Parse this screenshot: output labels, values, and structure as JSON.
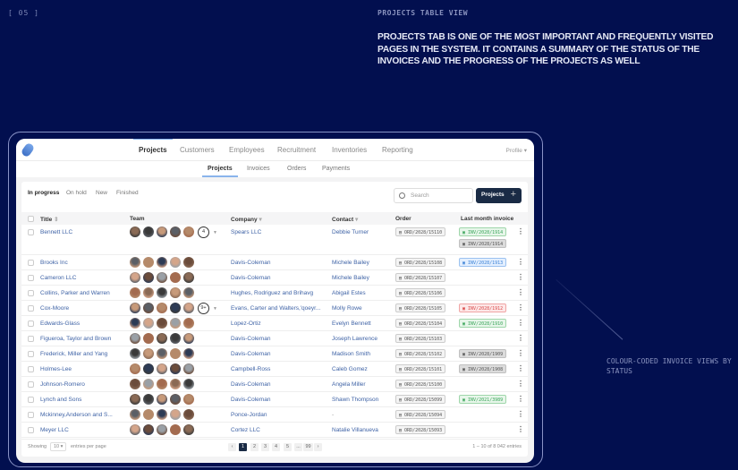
{
  "slide": {
    "number": "[ 05 ]",
    "section_title": "PROJECTS TABLE VIEW",
    "description": "PROJECTS TAB IS ONE OF THE MOST IMPORTANT AND FREQUENTLY VISITED PAGES IN THE SYSTEM. IT CONTAINS A SUMMARY OF THE STATUS OF THE INVOICES AND THE PROGRESS OF THE PROJECTS AS WELL",
    "callout": "COLOUR-CODED INVOICE VIEWS BY STATUS"
  },
  "topnav": {
    "items": [
      "Projects",
      "Customers",
      "Employees",
      "Recruitment",
      "Inventories",
      "Reporting"
    ],
    "active": 0,
    "profile": "Profile"
  },
  "subnav": {
    "items": [
      "Projects",
      "Invoices",
      "Orders",
      "Payments"
    ],
    "active": 0
  },
  "filters": {
    "items": [
      "In progress",
      "On hold",
      "New",
      "Finished"
    ],
    "active": 0
  },
  "search": {
    "placeholder": "Search"
  },
  "add_button": {
    "label": "Projects"
  },
  "table": {
    "columns": [
      "Title",
      "Team",
      "Company",
      "Contact",
      "Order",
      "Last month invoice"
    ],
    "rows": [
      {
        "title": "Bennett LLC",
        "extra": "4",
        "company": "Spears LLC",
        "contact": "Debbie Turner",
        "order": "ORD/2028/15110",
        "invoices": [
          {
            "id": "INV/2028/1914",
            "status": "green"
          },
          {
            "id": "INV/2028/1914",
            "status": "grey"
          }
        ]
      },
      {
        "title": "Brooks Inc",
        "company": "Davis-Coleman",
        "contact": "Michele Bailey",
        "order": "ORD/2028/15108",
        "invoices": [
          {
            "id": "INV/2028/1913",
            "status": "blue"
          }
        ]
      },
      {
        "title": "Cameron LLC",
        "company": "Davis-Coleman",
        "contact": "Michele Bailey",
        "order": "ORD/2028/15107",
        "invoices": []
      },
      {
        "title": "Collins, Parker and Warren",
        "company": "Hughes, Rodriguez and Brihavg",
        "contact": "Abigail Estes",
        "order": "ORD/2028/15106",
        "invoices": []
      },
      {
        "title": "Cox-Moore",
        "extra": "9+",
        "company": "Evans, Carter and Walters,'qoeyr...",
        "contact": "Molly Rowe",
        "order": "ORD/2028/15105",
        "invoices": [
          {
            "id": "INV/2028/1912",
            "status": "red"
          }
        ]
      },
      {
        "title": "Edwards-Glass",
        "company": "Lopez-Ortiz",
        "contact": "Evelyn Bennett",
        "order": "ORD/2028/15104",
        "invoices": [
          {
            "id": "INV/2028/1910",
            "status": "green"
          }
        ]
      },
      {
        "title": "Figueroa, Taylor and Brown",
        "company": "Davis-Coleman",
        "contact": "Joseph Lawrence",
        "order": "ORD/2028/15103",
        "invoices": []
      },
      {
        "title": "Frederick, Miller and Yang",
        "company": "Davis-Coleman",
        "contact": "Madison Smith",
        "order": "ORD/2028/15102",
        "invoices": [
          {
            "id": "INV/2028/1909",
            "status": "grey"
          }
        ]
      },
      {
        "title": "Holmes-Lee",
        "company": "Campbell-Ross",
        "contact": "Caleb Gomez",
        "order": "ORD/2028/15101",
        "invoices": [
          {
            "id": "INV/2028/1908",
            "status": "grey"
          }
        ]
      },
      {
        "title": "Johnson-Romero",
        "company": "Davis-Coleman",
        "contact": "Angela Miller",
        "order": "ORD/2028/15100",
        "invoices": []
      },
      {
        "title": "Lynch and Sons",
        "company": "Davis-Coleman",
        "contact": "Shawn Thompson",
        "order": "ORD/2028/15099",
        "invoices": [
          {
            "id": "INV/2021/3989",
            "status": "green"
          }
        ]
      },
      {
        "title": "Mckinney,Anderson and S...",
        "company": "Ponce-Jordan",
        "contact": "-",
        "order": "ORD/2028/15094",
        "invoices": []
      },
      {
        "title": "Meyer LLC",
        "company": "Cortez LLC",
        "contact": "Natalie Villanueva",
        "order": "ORD/2028/15093",
        "invoices": []
      }
    ]
  },
  "status_colors": {
    "green": "#3aa55a",
    "blue": "#3b82d6",
    "red": "#d94848",
    "grey": "#555555"
  },
  "footer": {
    "showing": "Showing",
    "per_page": "10",
    "entries_label": "entries per page",
    "pages": [
      "1",
      "2",
      "3",
      "4",
      "5",
      "...",
      "99"
    ],
    "active_page": "1",
    "summary": "1 – 10 of 8 042 entries"
  }
}
